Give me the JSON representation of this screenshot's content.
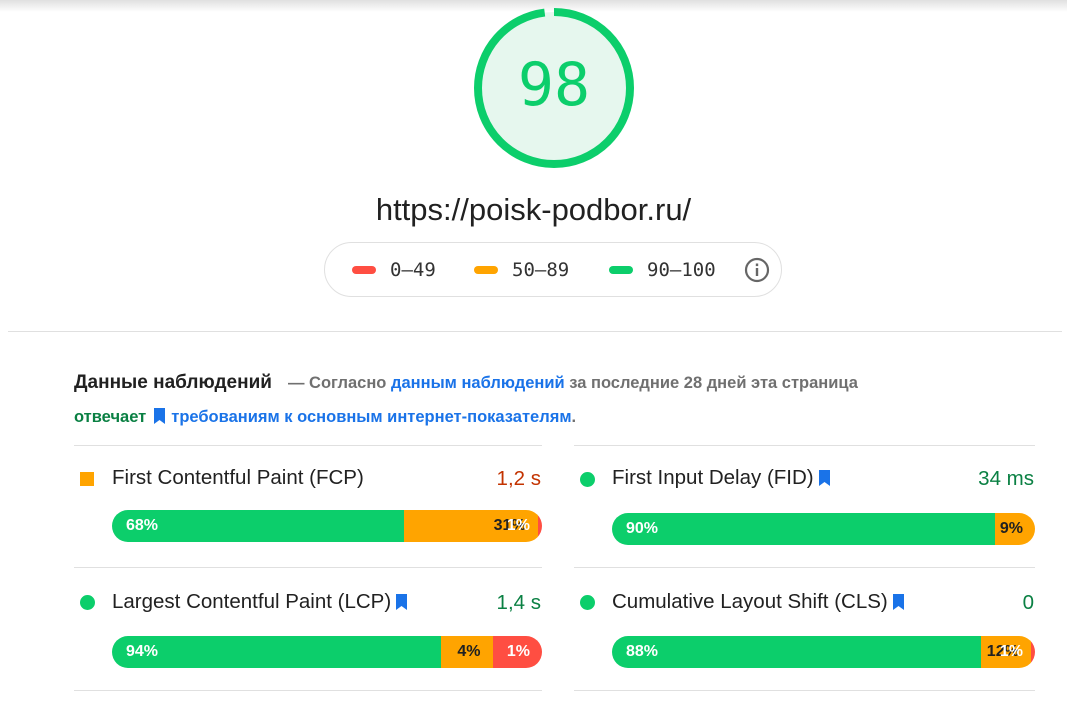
{
  "score": {
    "value": "98",
    "fraction": 0.98,
    "color": "#0cce6b"
  },
  "url": "https://poisk-podbor.ru/",
  "legend": {
    "items": [
      {
        "label": "0–49",
        "color": "#ff4e42"
      },
      {
        "label": "50–89",
        "color": "#ffa400"
      },
      {
        "label": "90–100",
        "color": "#0cce6b"
      }
    ],
    "info_icon": "info-icon"
  },
  "field_data": {
    "title": "Данные наблюдений",
    "dash": "—",
    "text1": "Согласно",
    "link1": "данным наблюдений",
    "text2": "за последние 28 дней эта страница",
    "pass_word": "отвечает",
    "link2": "требованиям к основным интернет-показателям",
    "period": "."
  },
  "metrics": {
    "fcp": {
      "name": "First Contentful Paint (FCP)",
      "value": "1,2 s",
      "value_color": "#c33300",
      "marker": "orange-square",
      "core": false,
      "dist": [
        "68%",
        "31%",
        "1%"
      ],
      "fractions": [
        0.68,
        0.31,
        0.01
      ]
    },
    "fid": {
      "name": "First Input Delay (FID)",
      "value": "34 ms",
      "value_color": "#0a8043",
      "marker": "green-circle",
      "core": true,
      "dist": [
        "90%",
        "9%",
        ""
      ],
      "fractions": [
        0.905,
        0.095,
        0
      ]
    },
    "lcp": {
      "name": "Largest Contentful Paint (LCP)",
      "value": "1,4 s",
      "value_color": "#0a8043",
      "marker": "green-circle",
      "core": true,
      "dist": [
        "94%",
        "4%",
        "1%"
      ],
      "fractions": [
        0.765,
        0.12,
        0.115
      ]
    },
    "cls": {
      "name": "Cumulative Layout Shift (CLS)",
      "value": "0",
      "value_color": "#0a8043",
      "marker": "green-circle",
      "core": true,
      "dist": [
        "88%",
        "12%",
        "1%"
      ],
      "fractions": [
        0.88,
        0.12,
        0.01
      ]
    }
  }
}
